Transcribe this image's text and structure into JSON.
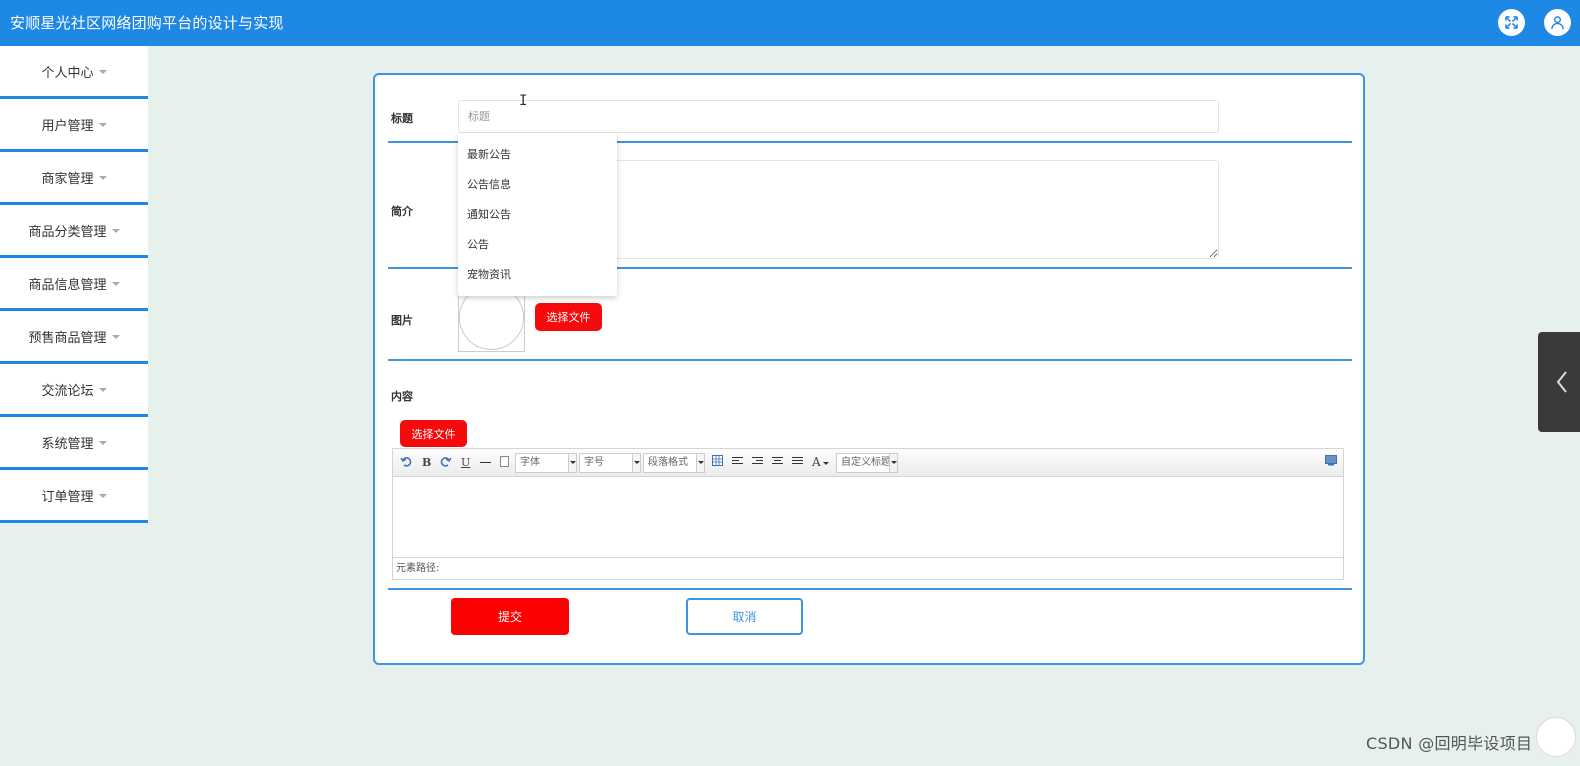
{
  "app": {
    "title": "安顺星光社区网络团购平台的设计与实现"
  },
  "sidebar": {
    "items": [
      {
        "label": "个人中心"
      },
      {
        "label": "用户管理"
      },
      {
        "label": "商家管理"
      },
      {
        "label": "商品分类管理"
      },
      {
        "label": "商品信息管理"
      },
      {
        "label": "预售商品管理"
      },
      {
        "label": "交流论坛"
      },
      {
        "label": "系统管理"
      },
      {
        "label": "订单管理"
      }
    ]
  },
  "form": {
    "title_label": "标题",
    "title_placeholder": "标题",
    "title_value": "",
    "intro_label": "简介",
    "image_label": "图片",
    "image_choose_label": "选择文件",
    "content_label": "内容",
    "content_choose_label": "选择文件",
    "submit_label": "提交",
    "cancel_label": "取消"
  },
  "autocomplete": {
    "options": [
      "最新公告",
      "公告信息",
      "通知公告",
      "公告",
      "宠物资讯"
    ]
  },
  "editor": {
    "font_family_select": "字体",
    "font_size_select": "字号",
    "paragraph_select": "段落格式",
    "custom_title_select": "自定义标题",
    "bold": "B",
    "underline": "U",
    "font_color": "A",
    "path_label": "元素路径:"
  },
  "watermark": "CSDN @回明毕设项目",
  "colors": {
    "header": "#1e88e5",
    "accent": "#3d94e0",
    "danger": "#f50b0b",
    "background": "#e6f0ec"
  }
}
